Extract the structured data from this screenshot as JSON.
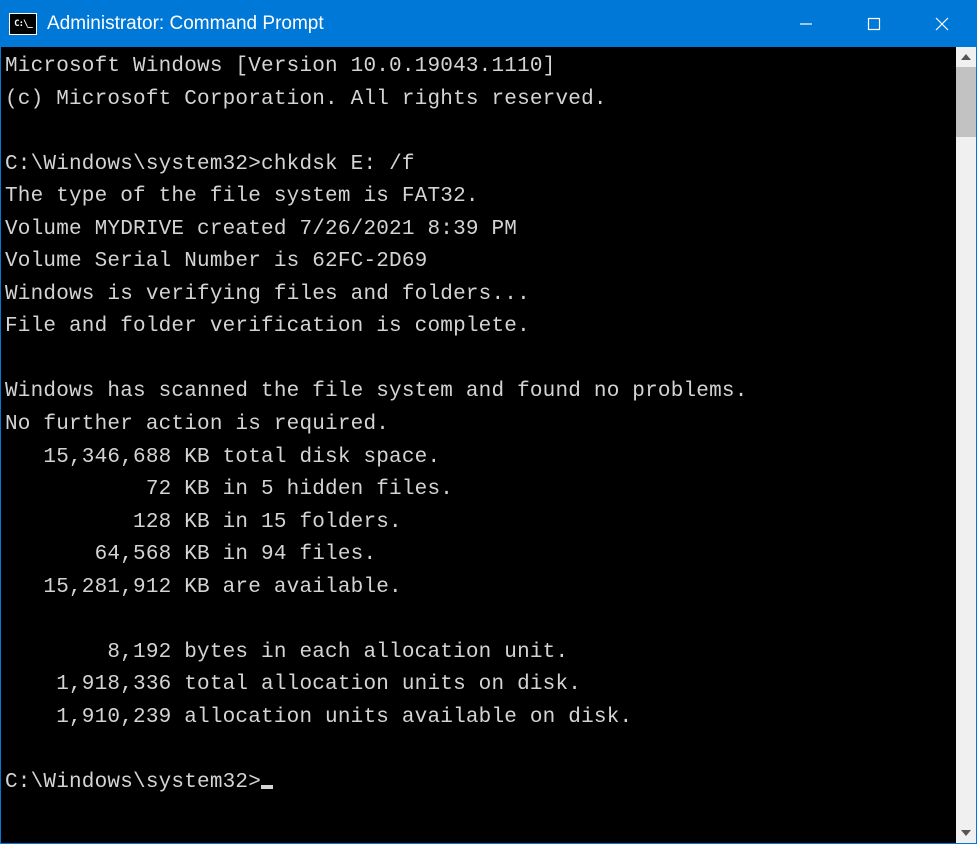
{
  "window": {
    "title": "Administrator: Command Prompt"
  },
  "terminal": {
    "banner_line1": "Microsoft Windows [Version 10.0.19043.1110]",
    "banner_line2": "(c) Microsoft Corporation. All rights reserved.",
    "prompt1": "C:\\Windows\\system32>",
    "command1": "chkdsk E: /f",
    "out_line1": "The type of the file system is FAT32.",
    "out_line2": "Volume MYDRIVE created 7/26/2021 8:39 PM",
    "out_line3": "Volume Serial Number is 62FC-2D69",
    "out_line4": "Windows is verifying files and folders...",
    "out_line5": "File and folder verification is complete.",
    "out_line6": "Windows has scanned the file system and found no problems.",
    "out_line7": "No further action is required.",
    "out_line8": "   15,346,688 KB total disk space.",
    "out_line9": "           72 KB in 5 hidden files.",
    "out_line10": "          128 KB in 15 folders.",
    "out_line11": "       64,568 KB in 94 files.",
    "out_line12": "   15,281,912 KB are available.",
    "out_line13": "        8,192 bytes in each allocation unit.",
    "out_line14": "    1,918,336 total allocation units on disk.",
    "out_line15": "    1,910,239 allocation units available on disk.",
    "prompt2": "C:\\Windows\\system32>"
  }
}
